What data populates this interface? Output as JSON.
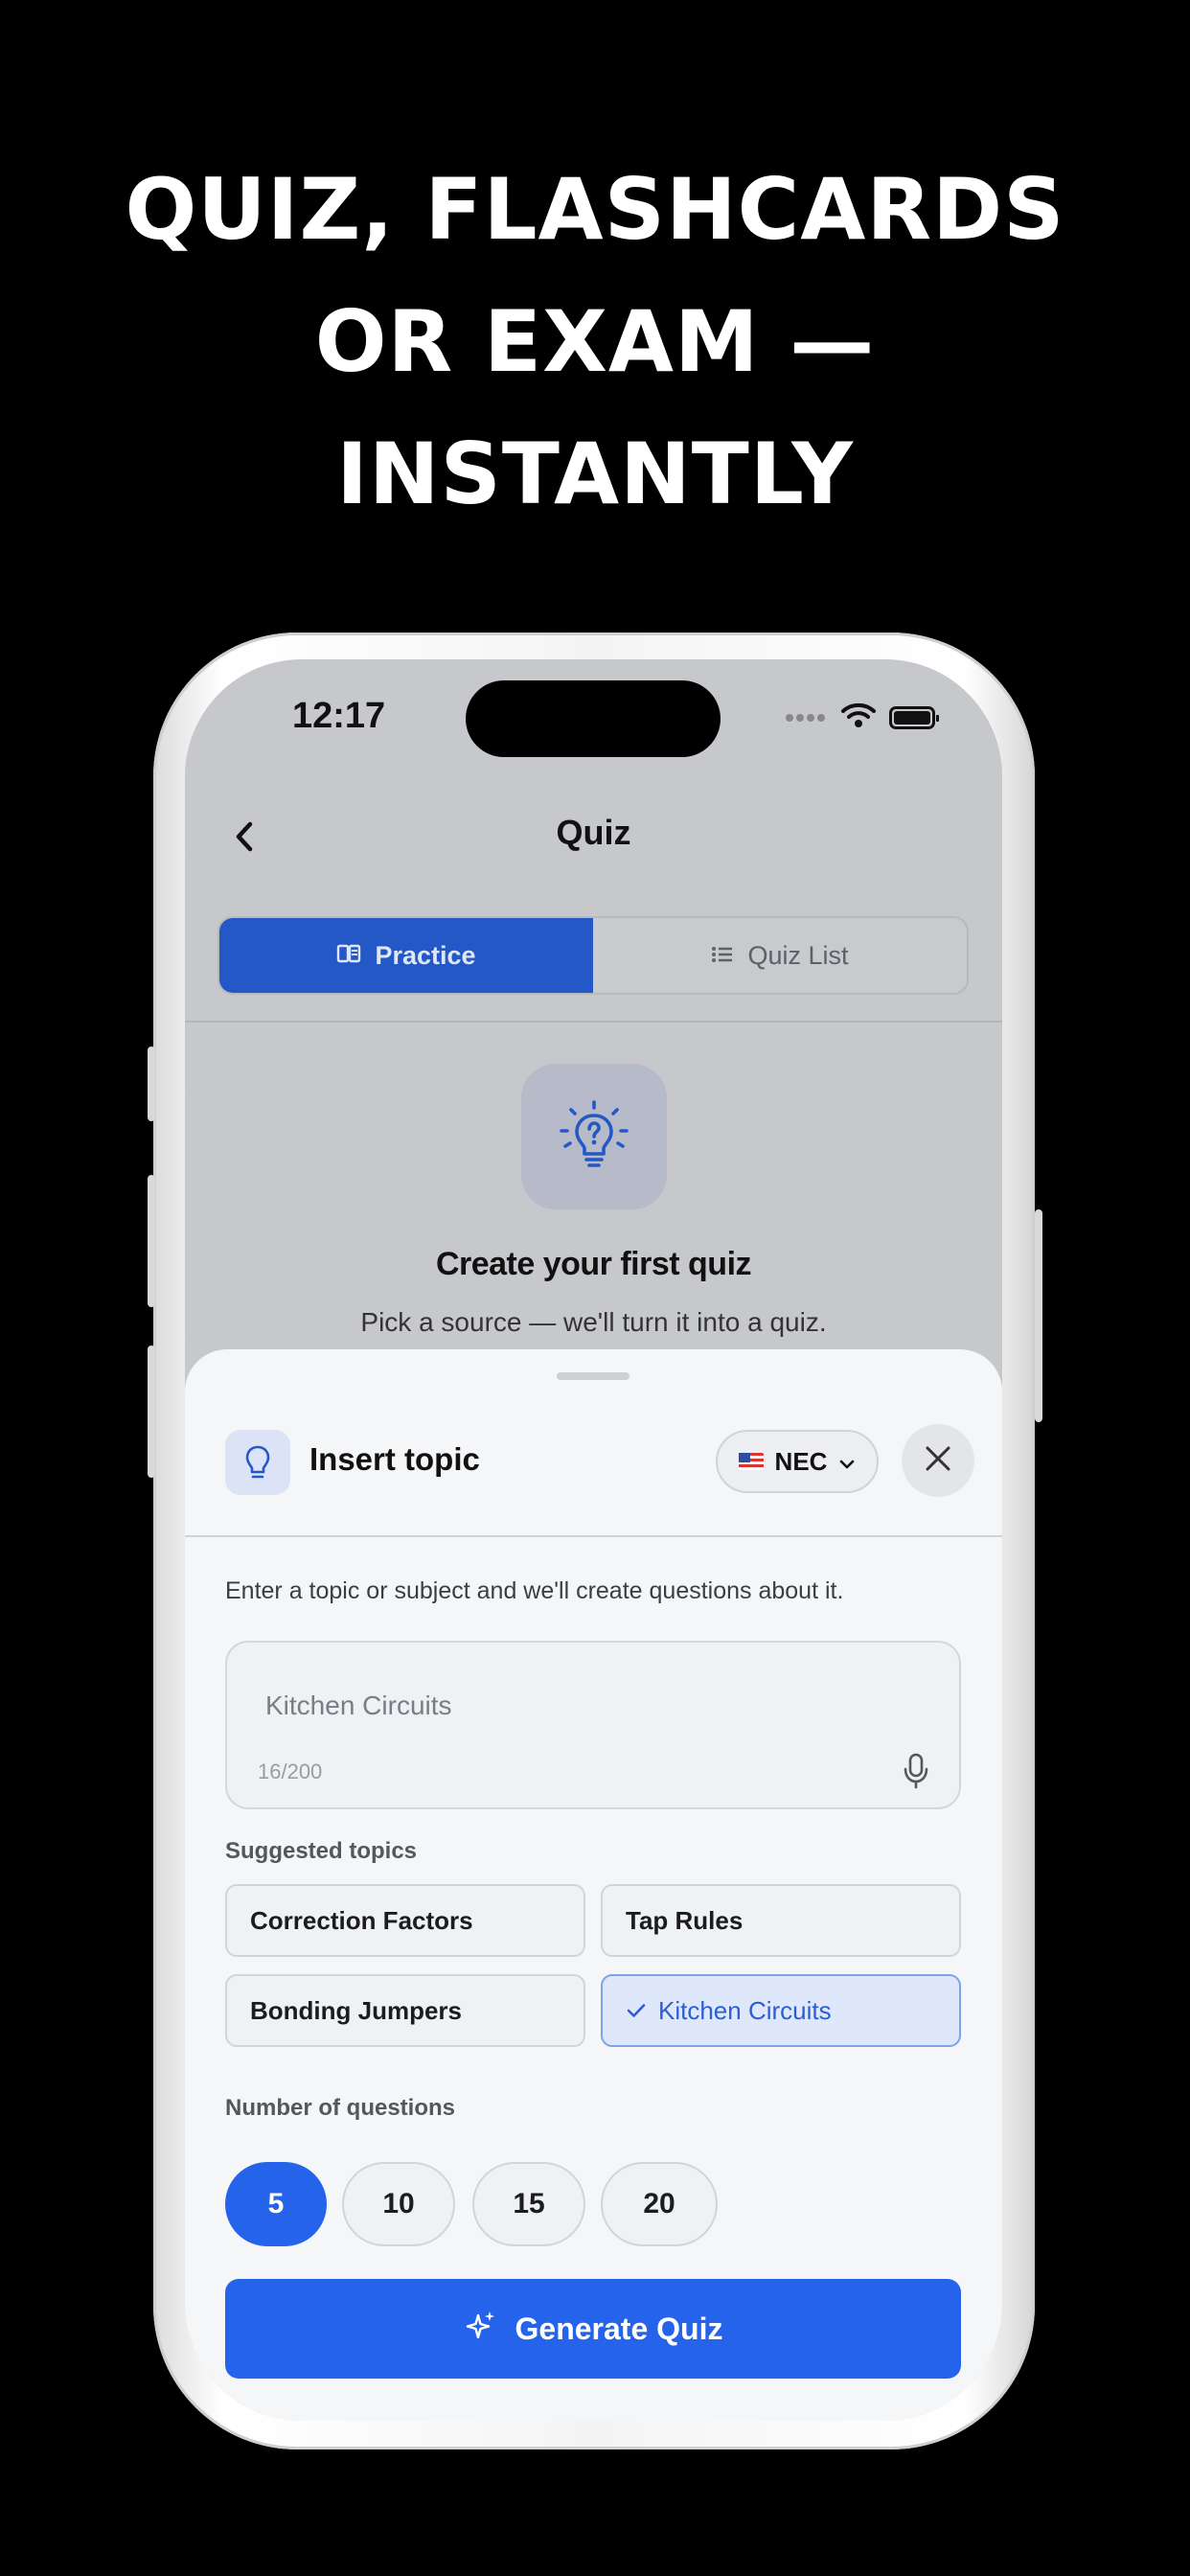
{
  "headline": {
    "line1": "QUIZ, FLASHCARDS",
    "line2": "OR EXAM —",
    "line3": "INSTANTLY"
  },
  "status_bar": {
    "time": "12:17",
    "icons": [
      "signal-icon",
      "wifi-icon",
      "battery-icon"
    ]
  },
  "nav": {
    "title": "Quiz",
    "back_icon": "chevron-left-icon"
  },
  "segment": {
    "practice_label": "Practice",
    "quiz_list_label": "Quiz List",
    "active": "Practice"
  },
  "empty_state": {
    "icon": "lightbulb-question-icon",
    "title": "Create your first quiz",
    "subtitle": "Pick a source — we'll turn it into a quiz."
  },
  "sheet": {
    "title": "Insert topic",
    "code_label": "NEC",
    "helper_text": "Enter a topic or subject and we'll create questions about it.",
    "topic_value": "Kitchen Circuits",
    "counter": "16/200",
    "suggested_label": "Suggested topics",
    "suggested_topics": [
      {
        "label": "Correction Factors",
        "selected": false
      },
      {
        "label": "Tap Rules",
        "selected": false
      },
      {
        "label": "Bonding Jumpers",
        "selected": false
      },
      {
        "label": "Kitchen Circuits",
        "selected": true
      }
    ],
    "questions_label": "Number of questions",
    "question_counts": [
      "5",
      "10",
      "15",
      "20"
    ],
    "selected_count": "5",
    "generate_label": "Generate Quiz"
  },
  "colors": {
    "accent": "#2563eb",
    "segment_active": "#2458c7",
    "background": "#000000"
  }
}
